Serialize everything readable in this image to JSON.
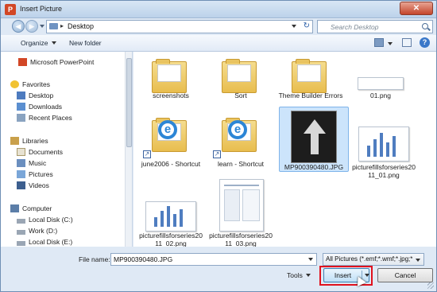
{
  "window": {
    "title": "Insert Picture",
    "app_icon_letter": "P",
    "close_glyph": "✕"
  },
  "nav": {
    "back_glyph": "◀",
    "forward_glyph": "▶",
    "address_chevron": "▸",
    "address": "Desktop",
    "refresh_glyph": "↻",
    "search_placeholder": "Search Desktop"
  },
  "toolbar": {
    "organize": "Organize",
    "new_folder": "New folder",
    "help_glyph": "?"
  },
  "sidebar": {
    "items": [
      {
        "label": "Microsoft PowerPoint",
        "icon": "powerpoint-icon"
      },
      {
        "label": "Favorites",
        "icon": "star-icon"
      },
      {
        "label": "Desktop",
        "icon": "desktop-icon"
      },
      {
        "label": "Downloads",
        "icon": "downloads-icon"
      },
      {
        "label": "Recent Places",
        "icon": "recent-places-icon"
      },
      {
        "label": "Libraries",
        "icon": "libraries-icon"
      },
      {
        "label": "Documents",
        "icon": "documents-icon"
      },
      {
        "label": "Music",
        "icon": "music-icon"
      },
      {
        "label": "Pictures",
        "icon": "pictures-icon"
      },
      {
        "label": "Videos",
        "icon": "videos-icon"
      },
      {
        "label": "Computer",
        "icon": "computer-icon"
      },
      {
        "label": "Local Disk (C:)",
        "icon": "drive-icon"
      },
      {
        "label": "Work (D:)",
        "icon": "drive-icon"
      },
      {
        "label": "Local Disk (E:)",
        "icon": "drive-icon"
      }
    ]
  },
  "files": [
    {
      "name": "screenshots",
      "type": "folder"
    },
    {
      "name": "Sort",
      "type": "folder"
    },
    {
      "name": "Theme Builder Errors",
      "type": "folder"
    },
    {
      "name": "01.png",
      "type": "image"
    },
    {
      "name": "june2006 - Shortcut",
      "type": "shortcut"
    },
    {
      "name": "learn - Shortcut",
      "type": "shortcut"
    },
    {
      "name": "MP900390480.JPG",
      "type": "image",
      "selected": true
    },
    {
      "name": "picturefillsforseries2011_01.png",
      "type": "image"
    },
    {
      "name": "picturefillsforseries2011_02.png",
      "type": "image"
    },
    {
      "name": "picturefillsforseries2011_03.png",
      "type": "image"
    }
  ],
  "footer": {
    "file_name_label": "File name:",
    "file_name_value": "MP900390480.JPG",
    "filter": "All Pictures (*.emf;*.wmf;*.jpg;*",
    "tools": "Tools",
    "insert": "Insert",
    "cancel": "Cancel"
  },
  "colors": {
    "highlight": "#e0121e",
    "selection": "#cce4fb"
  }
}
